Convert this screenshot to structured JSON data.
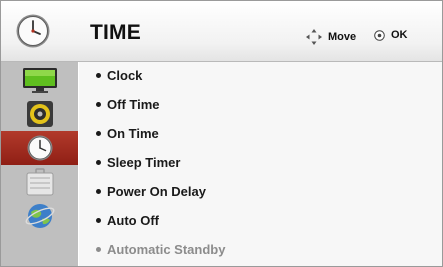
{
  "header": {
    "title": "TIME",
    "icon": "clock-icon",
    "hints": {
      "move_label": "Move",
      "ok_label": "OK"
    }
  },
  "sidebar": {
    "items": [
      {
        "icon": "picture-icon",
        "active": false
      },
      {
        "icon": "speaker-icon",
        "active": false
      },
      {
        "icon": "clock-icon",
        "active": true
      },
      {
        "icon": "lock-icon",
        "active": false
      },
      {
        "icon": "globe-icon",
        "active": false
      }
    ]
  },
  "menu": {
    "items": [
      {
        "label": "Clock",
        "enabled": true
      },
      {
        "label": "Off Time",
        "enabled": true
      },
      {
        "label": "On Time",
        "enabled": true
      },
      {
        "label": "Sleep Timer",
        "enabled": true
      },
      {
        "label": "Power On Delay",
        "enabled": true
      },
      {
        "label": "Auto Off",
        "enabled": true
      },
      {
        "label": "Automatic Standby",
        "enabled": false
      }
    ]
  },
  "colors": {
    "active_tab": "#9f2a1d",
    "sidebar_bg": "#bfbfbf",
    "disabled_text": "#8c8c8c"
  }
}
